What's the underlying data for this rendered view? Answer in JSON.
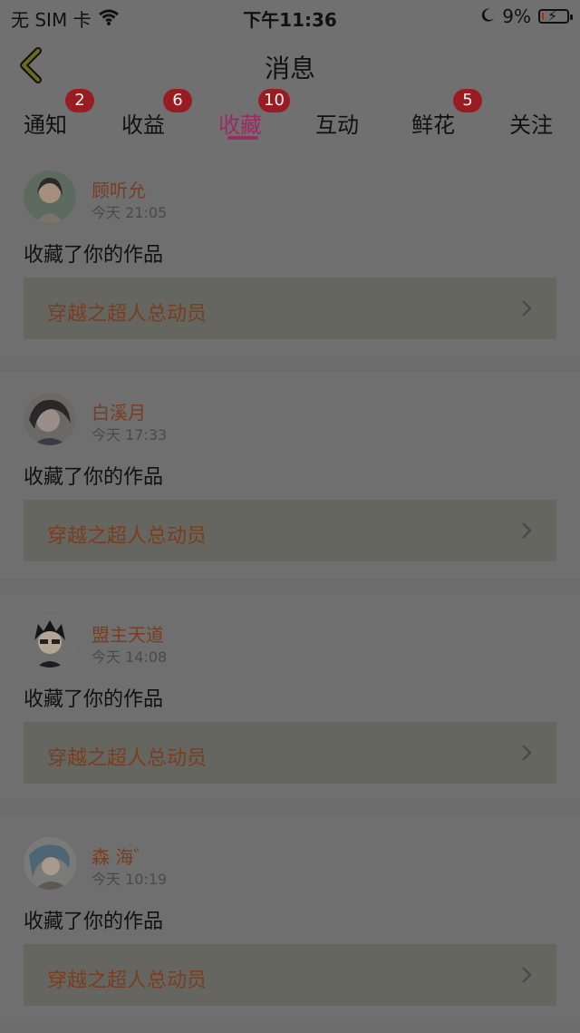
{
  "status": {
    "carrier": "无 SIM 卡",
    "time": "下午11:36",
    "battery": "9%",
    "battery_level": 0.09
  },
  "nav": {
    "title": "消息"
  },
  "tabs": [
    {
      "label": "通知",
      "badge": "2"
    },
    {
      "label": "收益",
      "badge": "6"
    },
    {
      "label": "收藏",
      "badge": "10",
      "active": true
    },
    {
      "label": "互动",
      "badge": ""
    },
    {
      "label": "鲜花",
      "badge": "5"
    },
    {
      "label": "关注",
      "badge": ""
    }
  ],
  "items": [
    {
      "username": "顾听允",
      "time": "今天 21:05",
      "action": "收藏了你的作品",
      "work": "穿越之超人总动员"
    },
    {
      "username": "白溪月",
      "time": "今天 17:33",
      "action": "收藏了你的作品",
      "work": "穿越之超人总动员"
    },
    {
      "username": "盟主天道",
      "time": "今天 14:08",
      "action": "收藏了你的作品",
      "work": "穿越之超人总动员"
    },
    {
      "username": "森 海゛",
      "time": "今天 10:19",
      "action": "收藏了你的作品",
      "work": "穿越之超人总动员"
    }
  ]
}
